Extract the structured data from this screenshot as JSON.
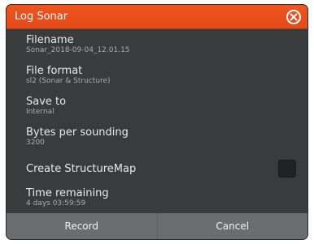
{
  "dialog": {
    "title": "Log Sonar",
    "fields": [
      {
        "label": "Filename",
        "value": "Sonar_2018-09-04_12.01.15"
      },
      {
        "label": "File format",
        "value": "sl2 (Sonar & Structure)"
      },
      {
        "label": "Save to",
        "value": "Internal"
      },
      {
        "label": "Bytes per sounding",
        "value": "3200"
      },
      {
        "label": "Create StructureMap",
        "value": ""
      },
      {
        "label": "Time remaining",
        "value": "4 days 03:59:59"
      }
    ],
    "buttons": {
      "record": "Record",
      "cancel": "Cancel"
    }
  },
  "colors": {
    "titlebar": "#e8511c",
    "background": "#3a3b3d",
    "buttonbar": "#6b6d70"
  },
  "icons": {
    "close": "close-icon"
  }
}
